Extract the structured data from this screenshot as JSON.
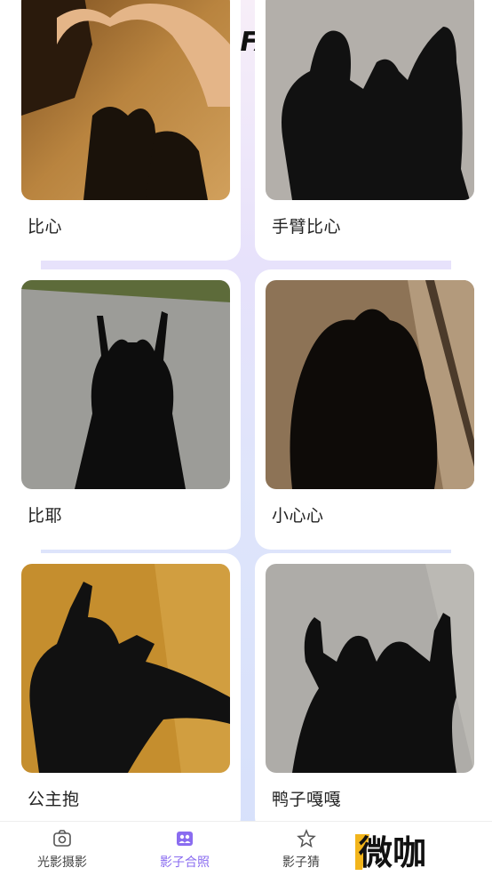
{
  "cards": [
    {
      "caption": "比心"
    },
    {
      "caption": "手臂比心"
    },
    {
      "caption": "比耶"
    },
    {
      "caption": "小心心"
    },
    {
      "caption": "公主抱"
    },
    {
      "caption": "鸭子嘎嘎"
    }
  ],
  "tabs": [
    {
      "label": "光影摄影",
      "icon": "camera-icon",
      "active": false
    },
    {
      "label": "影子合照",
      "icon": "people-icon",
      "active": true
    },
    {
      "label": "影子猜",
      "icon": "star-icon",
      "active": false
    }
  ],
  "watermark": {
    "text": "微咖"
  },
  "colors": {
    "accent": "#8a6cf0"
  }
}
